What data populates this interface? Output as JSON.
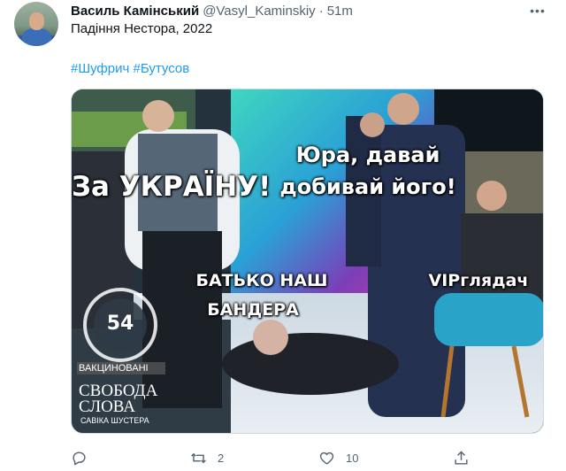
{
  "tweet": {
    "author_name": "Василь Камінський",
    "author_handle": "@Vasyl_Kaminskiy",
    "separator": "·",
    "time": "51m",
    "text": "Падіння Нестора, 2022",
    "hashtags": [
      "#Шуфрич",
      "#Бутусов"
    ],
    "more_label": "•••"
  },
  "image": {
    "caption_left": "За УКРАЇНУ!",
    "caption_right_line1": "Юра, давай",
    "caption_right_line2": "добивай його!",
    "caption_middle_line1": "БАТЬКО НАШ",
    "caption_middle_line2": "БАНДЕРА",
    "caption_vip": "VIPглядач",
    "logo_number": "54",
    "logo_vaccinated": "ВАКЦИНОВАНІ",
    "logo_show_line1": "СВОБОДА",
    "logo_show_line2": "СЛОВА",
    "logo_show_line3": "САВІКА ШУСТЕРА"
  },
  "actions": {
    "reply_count": "",
    "retweet_count": "2",
    "like_count": "10"
  },
  "colors": {
    "accent": "#1d9bf0",
    "muted": "#536471"
  },
  "icons": [
    "avatar",
    "more-icon",
    "reply-icon",
    "retweet-icon",
    "like-icon",
    "share-icon"
  ]
}
